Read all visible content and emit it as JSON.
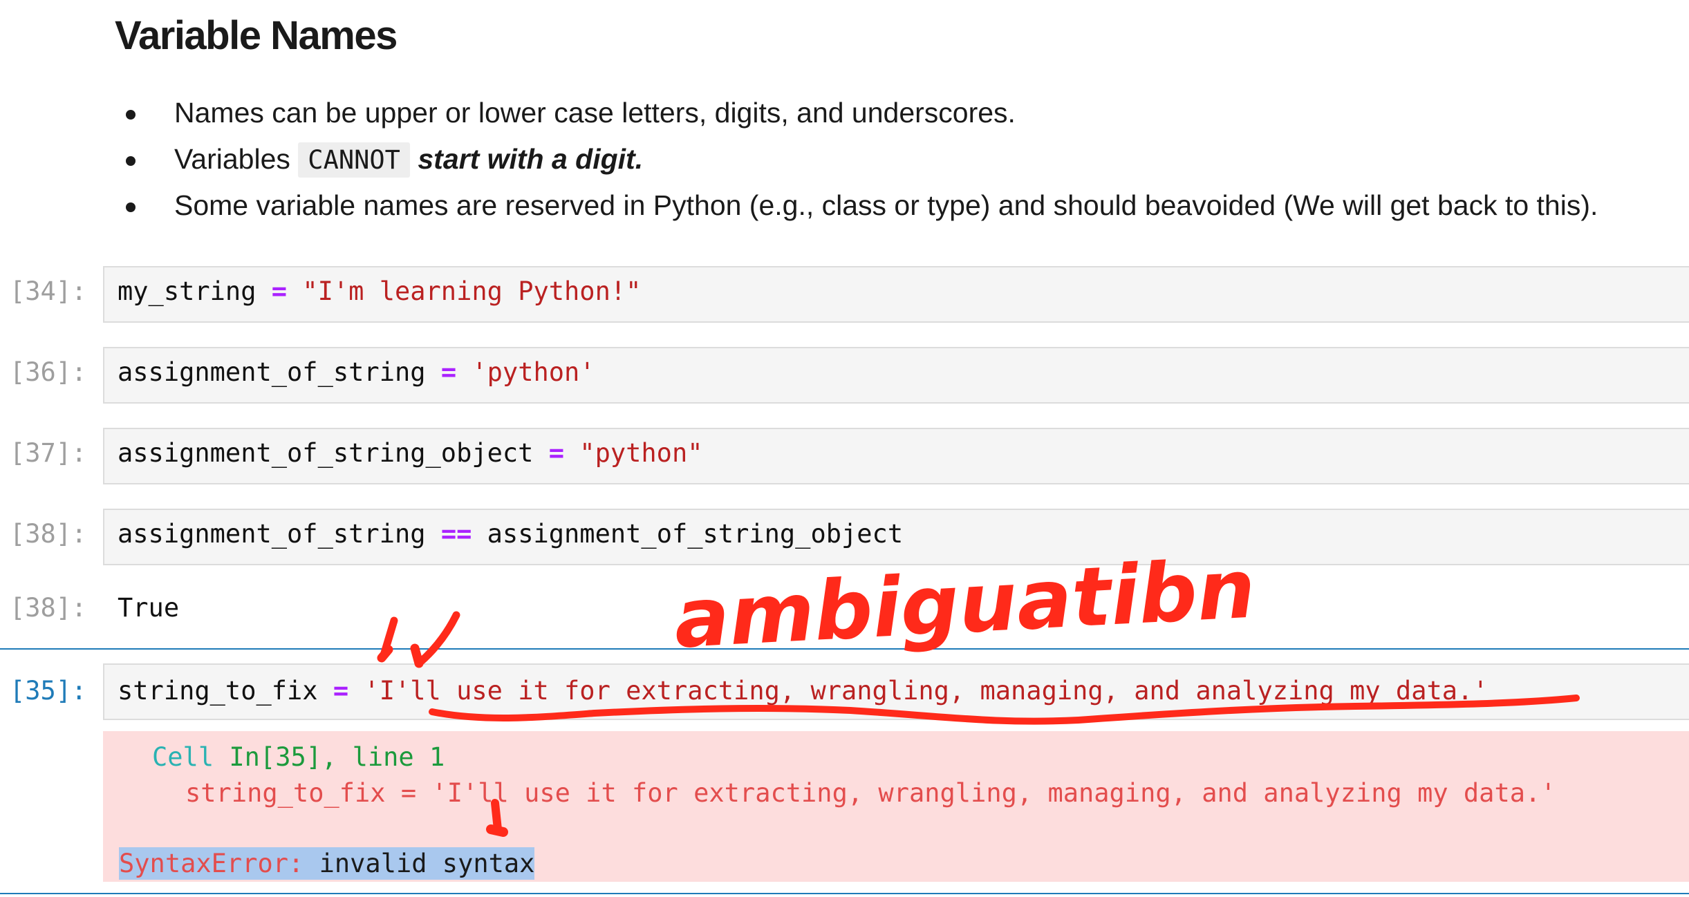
{
  "heading": "Variable Names",
  "bullets": {
    "b1": "Names can be upper or lower case letters, digits, and underscores.",
    "b2_prefix": "Variables",
    "b2_code": "CANNOT",
    "b2_emph": "start with a digit",
    "b2_suffix": ".",
    "b3": "Some variable names are reserved in Python (e.g., class or type) and should beavoided (We will get back to this)."
  },
  "cells": [
    {
      "prompt": "[34]:",
      "var": "my_string",
      "op": "=",
      "value": "\"I'm learning Python!\""
    },
    {
      "prompt": "[36]:",
      "var": "assignment_of_string",
      "op": "=",
      "value": "'python'"
    },
    {
      "prompt": "[37]:",
      "var": "assignment_of_string_object",
      "op": "=",
      "value": "\"python\""
    },
    {
      "prompt": "[38]:",
      "var": "assignment_of_string",
      "op": "==",
      "rhs": "assignment_of_string_object"
    },
    {
      "prompt": "[35]:",
      "var": "string_to_fix",
      "op": "=",
      "value": "'I'll use it for extracting, wrangling, managing, and analyzing my data.'"
    }
  ],
  "output": {
    "prompt": "[38]:",
    "value": "True"
  },
  "error": {
    "cell_label": "Cell",
    "cell_ref": "In[35], line 1",
    "code_line": "string_to_fix = 'I'll use it for extracting, wrangling, managing, and analyzing my data.'",
    "error_type": "SyntaxError:",
    "error_msg": " invalid syntax"
  },
  "annotation": {
    "handwritten": "ambiguatibn",
    "color": "#ff2a1a"
  },
  "colors": {
    "operator": "#aa22ff",
    "string": "#ba2121",
    "prompt": "#9e9e9e",
    "active_prompt": "#1f7bb8",
    "error_bg": "#fddddd",
    "highlight": "#a9c8ee"
  }
}
